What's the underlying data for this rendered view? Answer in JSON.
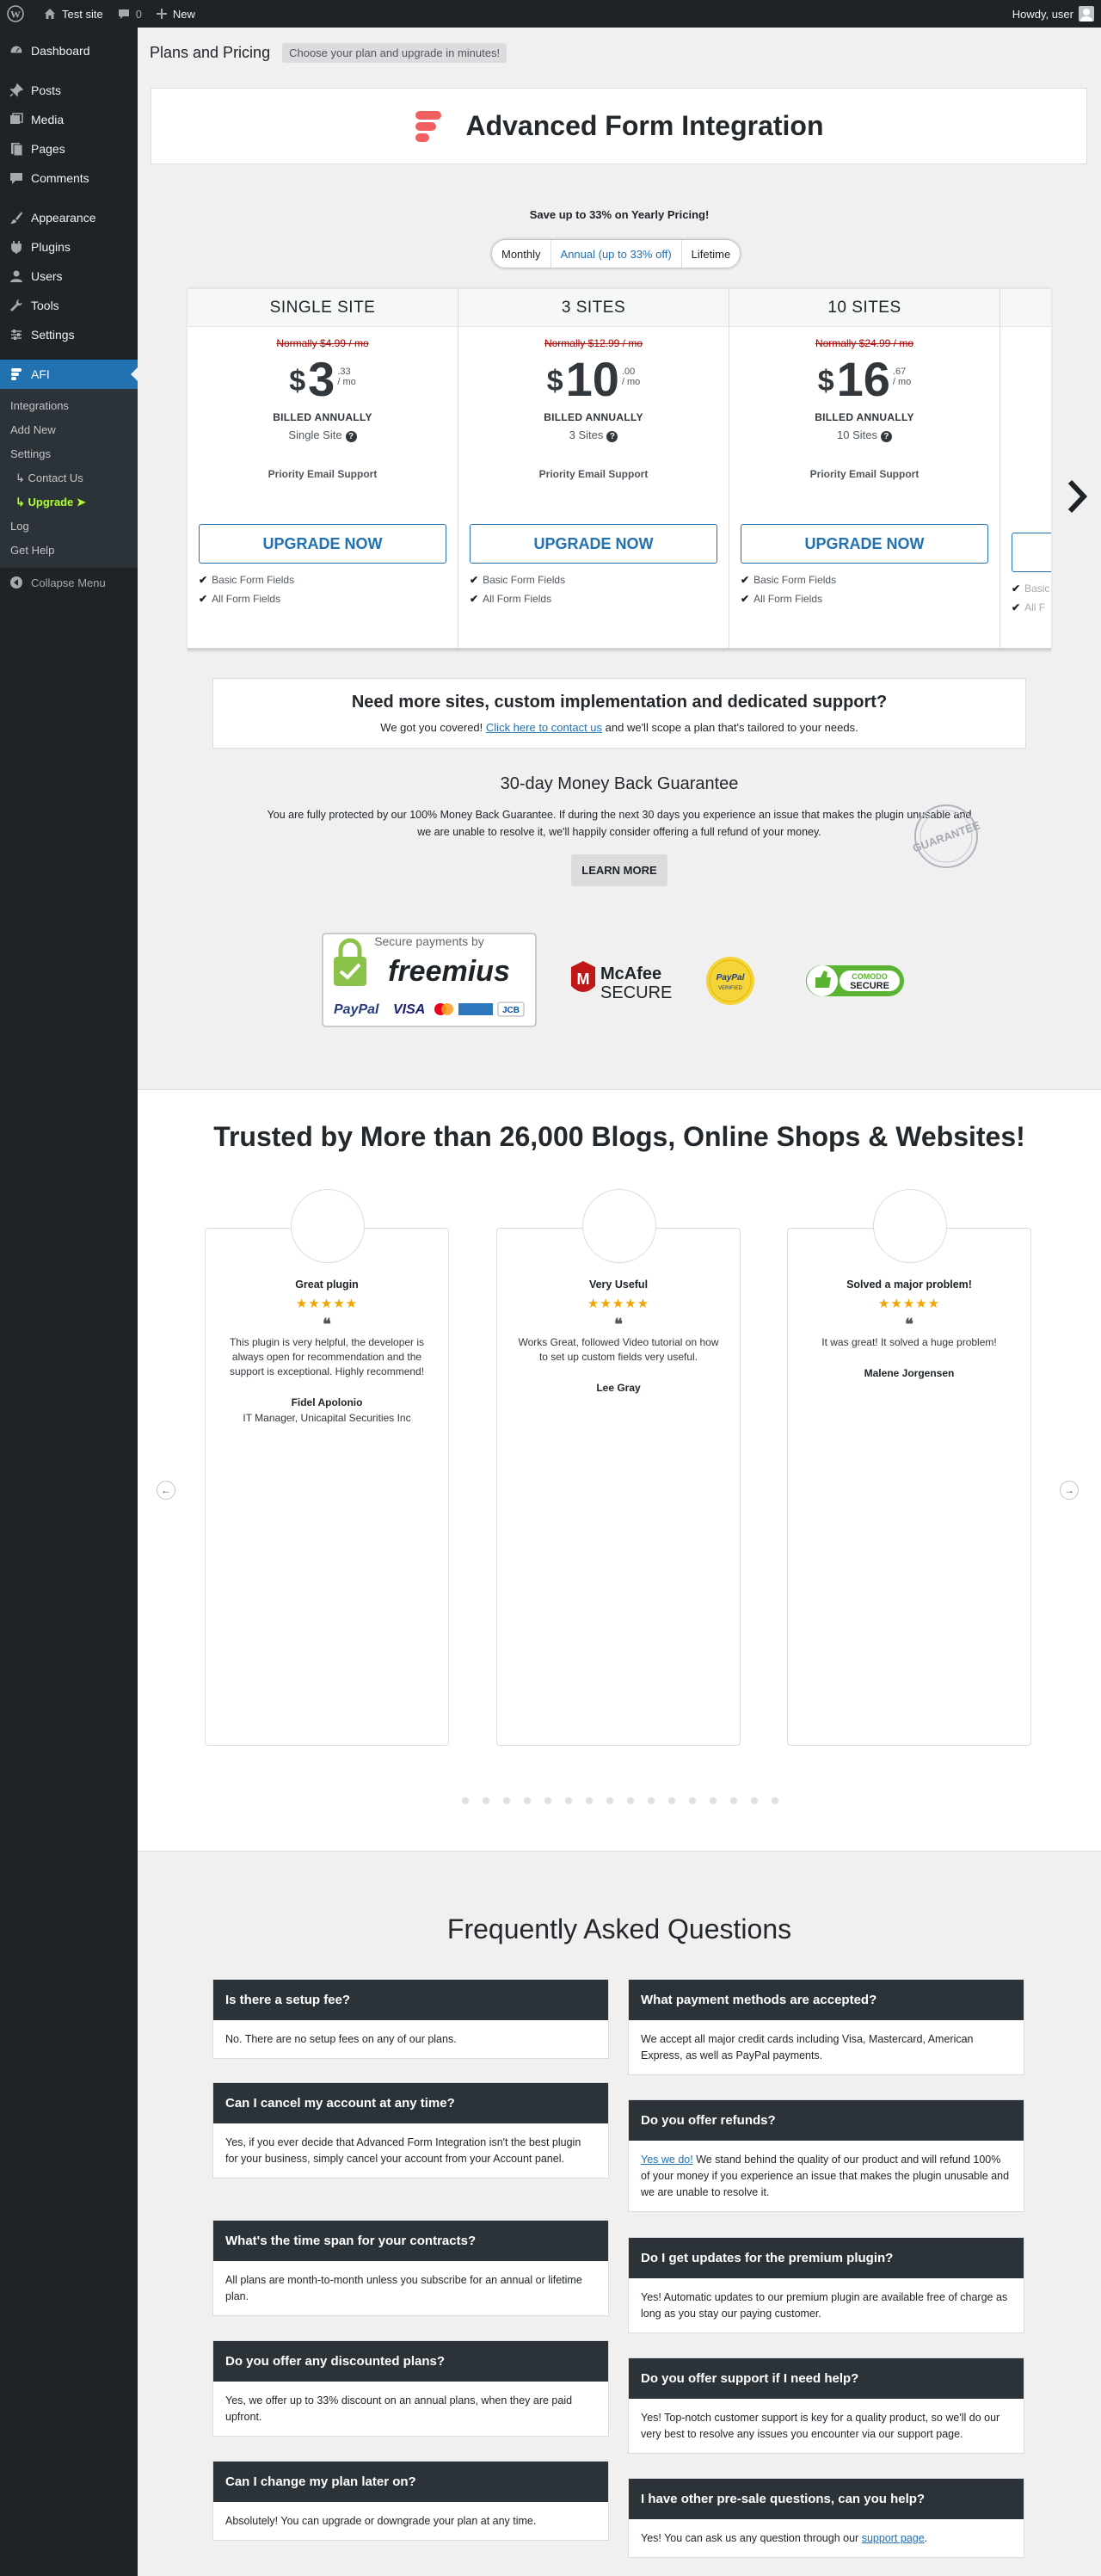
{
  "adminbar": {
    "site": "Test site",
    "comments": "0",
    "new": "New",
    "howdy": "Howdy, user"
  },
  "menu": {
    "items": [
      "Dashboard",
      "Posts",
      "Media",
      "Pages",
      "Comments",
      "Appearance",
      "Plugins",
      "Users",
      "Tools",
      "Settings"
    ],
    "active": "AFI",
    "sub": [
      "Integrations",
      "Add New",
      "Settings",
      "↳ Contact Us",
      "↳ Upgrade ➤",
      "Log",
      "Get Help"
    ],
    "collapse": "Collapse Menu"
  },
  "page": {
    "title": "Plans and Pricing",
    "tagline": "Choose your plan and upgrade in minutes!",
    "brand": "Advanced Form Integration",
    "save_note": "Save up to 33% on Yearly Pricing!"
  },
  "billing": {
    "options": [
      "Monthly",
      "Annual (up to 33% off)",
      "Lifetime"
    ],
    "selected": "Annual (up to 33% off)"
  },
  "plans": [
    {
      "name": "SINGLE SITE",
      "normally": "Normally $4.99 / mo",
      "currency": "$",
      "amount": "3",
      "cents": ".33",
      "per": "/ mo",
      "billed": "BILLED ANNUALLY",
      "sites": "Single Site",
      "support": "Priority Email Support",
      "button": "UPGRADE NOW",
      "features": [
        "Basic Form Fields",
        "All Form Fields"
      ]
    },
    {
      "name": "3 SITES",
      "normally": "Normally $12.99 / mo",
      "currency": "$",
      "amount": "10",
      "cents": ".00",
      "per": "/ mo",
      "billed": "BILLED ANNUALLY",
      "sites": "3 Sites",
      "support": "Priority Email Support",
      "button": "UPGRADE NOW",
      "features": [
        "Basic Form Fields",
        "All Form Fields"
      ]
    },
    {
      "name": "10 SITES",
      "normally": "Normally $24.99 / mo",
      "currency": "$",
      "amount": "16",
      "cents": ".67",
      "per": "/ mo",
      "billed": "BILLED ANNUALLY",
      "sites": "10 Sites",
      "support": "Priority Email Support",
      "button": "UPGRADE NOW",
      "features": [
        "Basic Form Fields",
        "All Form Fields"
      ]
    },
    {
      "name": "",
      "normally": "",
      "currency": "",
      "amount": "",
      "cents": "",
      "per": "",
      "billed": "",
      "sites": "",
      "support": "",
      "button": "",
      "features": [
        "Basic",
        "All F"
      ]
    }
  ],
  "custom": {
    "title": "Need more sites, custom implementation and dedicated support?",
    "pre": "We got you covered!",
    "link": "Click here to contact us",
    "post": "and we'll scope a plan that's tailored to your needs."
  },
  "guarantee": {
    "title": "30-day Money Back Guarantee",
    "text": "You are fully protected by our 100% Money Back Guarantee. If during the next 30 days you experience an issue that makes the plugin unusable and we are unable to resolve it, we'll happily consider offering a full refund of your money.",
    "button": "LEARN MORE",
    "stamp": "GUARANTEE"
  },
  "badges": {
    "secure": "Secure payments by",
    "freemius": "freemius",
    "paypal": "PayPal",
    "visa": "VISA",
    "jcb": "JCB",
    "mcafee": "McAfee",
    "mcafee_secure": "SECURE",
    "paypal_verified": "PayPal",
    "verified": "VERIFIED",
    "comodo": "COMODO",
    "comodo_secure": "SECURE"
  },
  "trusted": {
    "title": "Trusted by More than 26,000 Blogs, Online Shops & Websites!"
  },
  "reviews": [
    {
      "title": "Great plugin",
      "stars": "★★★★★",
      "text": "This plugin is very helpful, the developer is always open for recommendation and the support is exceptional. Highly recommend!",
      "name": "Fidel Apolonio",
      "role": "IT Manager, Unicapital Securities Inc"
    },
    {
      "title": "Very Useful",
      "stars": "★★★★★",
      "text": "Works Great, followed Video tutorial on how to set up custom fields very useful.",
      "name": "Lee Gray",
      "role": ""
    },
    {
      "title": "Solved a major problem!",
      "stars": "★★★★★",
      "text": "It was great! It solved a huge problem!",
      "name": "Malene Jorgensen",
      "role": ""
    }
  ],
  "faq": {
    "title": "Frequently Asked Questions",
    "left": [
      {
        "q": "Is there a setup fee?",
        "a": "No. There are no setup fees on any of our plans."
      },
      {
        "q": "Can I cancel my account at any time?",
        "a": "Yes, if you ever decide that Advanced Form Integration isn't the best plugin for your business, simply cancel your account from your Account panel."
      },
      {
        "q": "What's the time span for your contracts?",
        "a": "All plans are month-to-month unless you subscribe for an annual or lifetime plan."
      },
      {
        "q": "Do you offer any discounted plans?",
        "a": "Yes, we offer up to 33% discount on an annual plans, when they are paid upfront."
      },
      {
        "q": "Can I change my plan later on?",
        "a": "Absolutely! You can upgrade or downgrade your plan at any time."
      }
    ],
    "right": [
      {
        "q": "What payment methods are accepted?",
        "a": "We accept all major credit cards including Visa, Mastercard, American Express, as well as PayPal payments."
      },
      {
        "q": "Do you offer refunds?",
        "link": "Yes we do!",
        "a": "We stand behind the quality of our product and will refund 100% of your money if you experience an issue that makes the plugin unusable and we are unable to resolve it."
      },
      {
        "q": "Do I get updates for the premium plugin?",
        "a": "Yes! Automatic updates to our premium plugin are available free of charge as long as you stay our paying customer."
      },
      {
        "q": "Do you offer support if I need help?",
        "a": "Yes! Top-notch customer support is key for a quality product, so we'll do our very best to resolve any issues you encounter via our support page."
      },
      {
        "q": "I have other pre-sale questions, can you help?",
        "a": "Yes! You can ask us any question through our",
        "link": "support page",
        "post": "."
      }
    ]
  }
}
